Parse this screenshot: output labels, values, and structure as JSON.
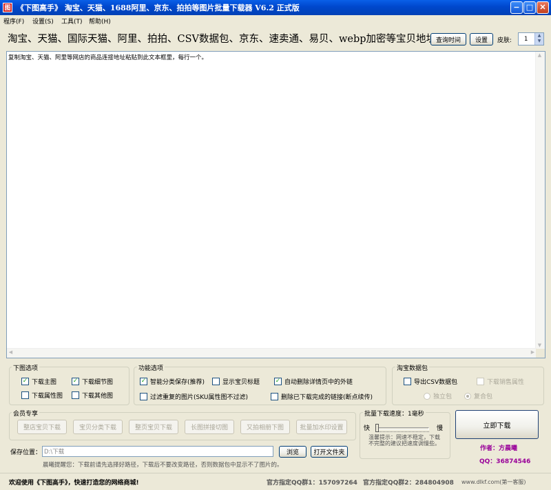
{
  "window": {
    "app_icon_glyph": "图",
    "title": "《下图高手》 淘宝、天猫、1688阿里、京东、拍拍等图片批量下载器 V6.2  正式版",
    "min_glyph": "−",
    "max_glyph": "□",
    "close_glyph": "✕"
  },
  "menu": [
    "程序(F)",
    "设置(S)",
    "工具(T)",
    "帮助(H)"
  ],
  "header": {
    "url_label": "淘宝、天猫、国际天猫、阿里、拍拍、CSV数据包、京东、速卖通、易贝、webp加密等宝贝地址:",
    "query_time_button": "查询时间",
    "settings_button": "设置",
    "skin_label": "皮肤:",
    "skin_value": "1"
  },
  "url_area": {
    "placeholder": "复制淘宝、天猫、阿里等网店的商品连接地址粘贴到此文本框里，每行一个。"
  },
  "download_options": {
    "legend": "下图选项",
    "items": [
      {
        "label": "下载主图",
        "checked": true
      },
      {
        "label": "下载细节图",
        "checked": true
      },
      {
        "label": "下载属性图",
        "checked": false
      },
      {
        "label": "下载其他图",
        "checked": false
      }
    ]
  },
  "feature_options": {
    "legend": "功能选项",
    "items": [
      {
        "label": "智能分类保存(推荐)",
        "checked": true
      },
      {
        "label": "显示宝贝标题",
        "checked": false
      },
      {
        "label": "自动删除详情页中的外链",
        "checked": true
      },
      {
        "label": "过滤重复的图片(SKU属性图不过滤)",
        "checked": false
      },
      {
        "label": "删除已下载完成的链接(断点续传)",
        "checked": false
      }
    ]
  },
  "taobao_data": {
    "legend": "淘宝数据包",
    "export_csv": "导出CSV数据包",
    "download_sales_attr": "下载销售属性",
    "radio_single": "独立包",
    "radio_combined": "复合包"
  },
  "member": {
    "legend": "会员专享",
    "buttons": [
      "整店宝贝下载",
      "宝贝分类下载",
      "整页宝贝下载",
      "长图拼接切图",
      "又拍相册下图",
      "批量加水印设置"
    ]
  },
  "speed": {
    "legend": "批量下载速度：1毫秒",
    "fast_label": "快",
    "slow_label": "慢",
    "hint": "温馨提示：网速不稳定，下载不完整的建议把速度调慢些。",
    "level_fraction": 0.0
  },
  "actions": {
    "download_now": "立即下载",
    "author": "作者：方晨曦",
    "qq": "QQ：36874546"
  },
  "save": {
    "label": "保存位置：",
    "path": "D:\\下载",
    "browse_button": "浏览",
    "open_folder_button": "打开文件夹",
    "reminder": "晨曦提醒您：下载前请先选择好路径，下载后不要改变路径，否则数据包中显示不了图片的。"
  },
  "status": {
    "welcome": "欢迎使用《下图高手》，快速打造您的网络商城!",
    "qq_group1": "官方指定QQ群1：157097264",
    "qq_group2": "官方指定QQ群2：284804908",
    "site": "www.dlkf.com(第一客服)"
  },
  "colors": {
    "accent_text": "#990099",
    "check_mark": "#21A121",
    "titlebar": "#0047CC"
  }
}
